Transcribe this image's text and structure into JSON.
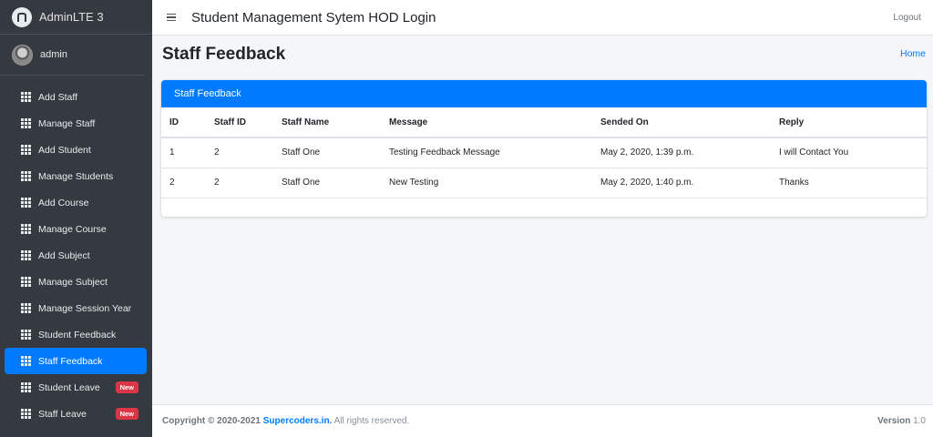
{
  "brand": {
    "name": "AdminLTE 3"
  },
  "user": {
    "name": "admin"
  },
  "sidebar": {
    "items": [
      {
        "label": "Add Staff",
        "active": false,
        "badge": ""
      },
      {
        "label": "Manage Staff",
        "active": false,
        "badge": ""
      },
      {
        "label": "Add Student",
        "active": false,
        "badge": ""
      },
      {
        "label": "Manage Students",
        "active": false,
        "badge": ""
      },
      {
        "label": "Add Course",
        "active": false,
        "badge": ""
      },
      {
        "label": "Manage Course",
        "active": false,
        "badge": ""
      },
      {
        "label": "Add Subject",
        "active": false,
        "badge": ""
      },
      {
        "label": "Manage Subject",
        "active": false,
        "badge": ""
      },
      {
        "label": "Manage Session Year",
        "active": false,
        "badge": ""
      },
      {
        "label": "Student Feedback",
        "active": false,
        "badge": ""
      },
      {
        "label": "Staff Feedback",
        "active": true,
        "badge": ""
      },
      {
        "label": "Student Leave",
        "active": false,
        "badge": "New"
      },
      {
        "label": "Staff Leave",
        "active": false,
        "badge": "New"
      }
    ]
  },
  "header": {
    "title": "Student Management Sytem HOD Login",
    "logout": "Logout"
  },
  "content": {
    "title": "Staff Feedback",
    "breadcrumb": "Home"
  },
  "card": {
    "title": "Staff Feedback",
    "columns": [
      "ID",
      "Staff ID",
      "Staff Name",
      "Message",
      "Sended On",
      "Reply"
    ],
    "rows": [
      [
        "1",
        "2",
        "Staff One",
        "Testing Feedback Message",
        "May 2, 2020, 1:39 p.m.",
        "I will Contact You"
      ],
      [
        "2",
        "2",
        "Staff One",
        "New Testing",
        "May 2, 2020, 1:40 p.m.",
        "Thanks"
      ]
    ]
  },
  "footer": {
    "copyright": "Copyright © 2020-2021",
    "company": "Supercoders.in.",
    "rights": "All rights reserved.",
    "version_label": "Version",
    "version": "1.0"
  },
  "colors": {
    "accent": "#007bff",
    "sidebar": "#343a40",
    "badge": "#dc3545"
  }
}
